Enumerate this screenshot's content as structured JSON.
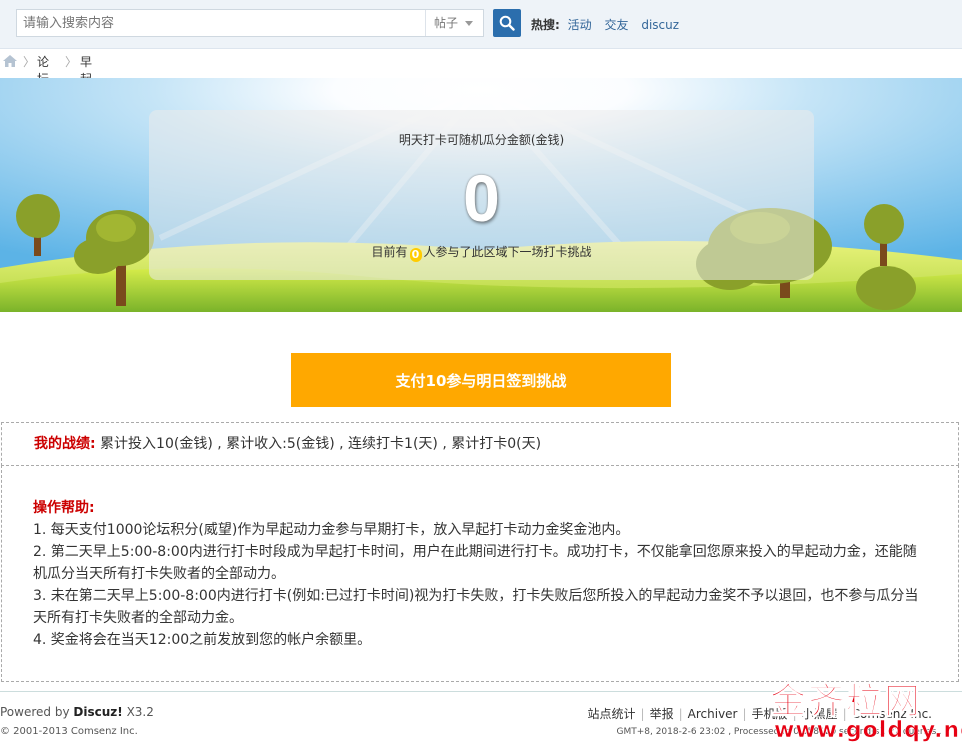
{
  "search": {
    "placeholder": "请输入搜索内容",
    "type": "帖子"
  },
  "hot": {
    "label": "热搜:",
    "links": [
      "活动",
      "交友",
      "discuz"
    ]
  },
  "breadcrumb": [
    "论坛",
    "早起挑战团"
  ],
  "banner": {
    "title": "明天打卡可随机瓜分金额(金钱)",
    "amount": "0",
    "sub_prefix": "目前有",
    "count": "0",
    "sub_suffix": "人参与了此区域下一场打卡挑战"
  },
  "pay_button": "支付10参与明日签到挑战",
  "stats": {
    "label": "我的战绩:",
    "text": " 累计投入10(金钱) , 累计收入:5(金钱) , 连续打卡1(天) , 累计打卡0(天)"
  },
  "help": {
    "title": "操作帮助:",
    "lines": [
      "1. 每天支付1000论坛积分(威望)作为早起动力金参与早期打卡，放入早起打卡动力金奖金池内。",
      "2. 第二天早上5:00-8:00内进行打卡时段成为早起打卡时间，用户在此期间进行打卡。成功打卡，不仅能拿回您原来投入的早起动力金，还能随机瓜分当天所有打卡失败者的全部动力。",
      "3. 未在第二天早上5:00-8:00内进行打卡(例如:已过打卡时间)视为打卡失败，打卡失败后您所投入的早起动力金奖不予以退回，也不参与瓜分当天所有打卡失败者的全部动力金。",
      "4. 奖金将会在当天12:00之前发放到您的帐户余额里。"
    ]
  },
  "footer": {
    "powered_prefix": "Powered by",
    "product": "Discuz!",
    "version": "X3.2",
    "copyright": "© 2001-2013 Comsenz Inc.",
    "links": [
      "站点统计",
      "举报",
      "Archiver",
      "手机版",
      "小黑屋",
      "Comsenz Inc."
    ],
    "gmt": "GMT+8, 2018-2-6 23:02 , Processed in 0.058120 second(s), 27 queries ."
  },
  "watermark": {
    "line1": "金齐粒网",
    "line2": "www.goldqy.net"
  }
}
